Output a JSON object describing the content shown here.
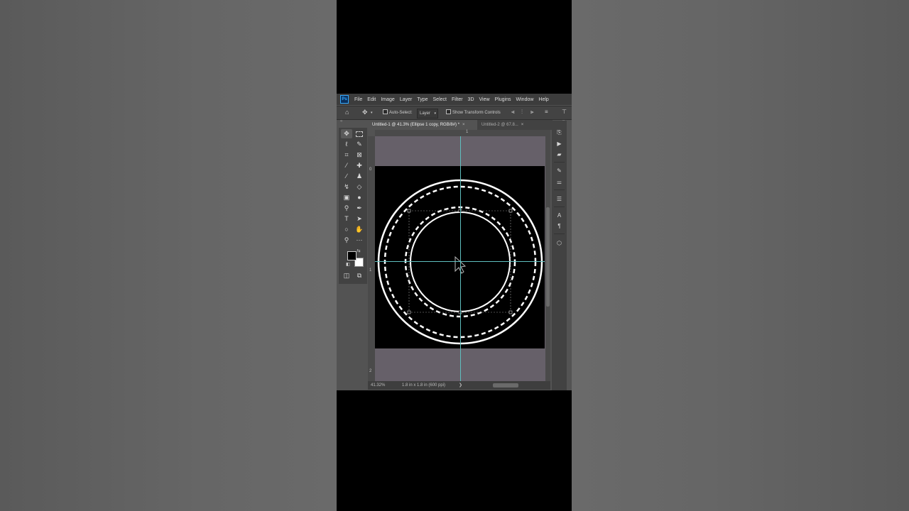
{
  "app": {
    "logo": "Ps"
  },
  "menu": [
    "File",
    "Edit",
    "Image",
    "Layer",
    "Type",
    "Select",
    "Filter",
    "3D",
    "View",
    "Plugins",
    "Window",
    "Help"
  ],
  "options": {
    "auto_select_label": "Auto-Select:",
    "auto_select_value": "Layer",
    "show_transform_label": "Show Transform Controls"
  },
  "tabs": [
    {
      "label": "Untitled-1 @ 41.3% (Ellipse 1 copy, RGB/8#) *",
      "active": true
    },
    {
      "label": "Untitled-2 @ 67.8...",
      "active": false
    }
  ],
  "rulers": {
    "h_mark": "1",
    "v_marks": [
      "0",
      "1",
      "2"
    ]
  },
  "status": {
    "zoom": "41.32%",
    "doc_info": "1.8 in x 1.8 in (600 ppi)",
    "arrow": "❯"
  },
  "tools": [
    "move-tool-icon",
    "marquee-tool-icon",
    "lasso-tool-icon",
    "quick-select-tool-icon",
    "crop-tool-icon",
    "frame-tool-icon",
    "eyedropper-tool-icon",
    "healing-tool-icon",
    "brush-tool-icon",
    "stamp-tool-icon",
    "history-brush-tool-icon",
    "eraser-tool-icon",
    "gradient-tool-icon",
    "blur-tool-icon",
    "dodge-tool-icon",
    "pen-tool-icon",
    "type-tool-icon",
    "path-select-tool-icon",
    "ellipse-tool-icon",
    "hand-tool-icon",
    "zoom-tool-icon",
    "more-tools-icon"
  ],
  "colors": {
    "foreground": "#000000",
    "background": "#ffffff",
    "guide": "#5fbfbf",
    "accent": "#31a8ff"
  }
}
